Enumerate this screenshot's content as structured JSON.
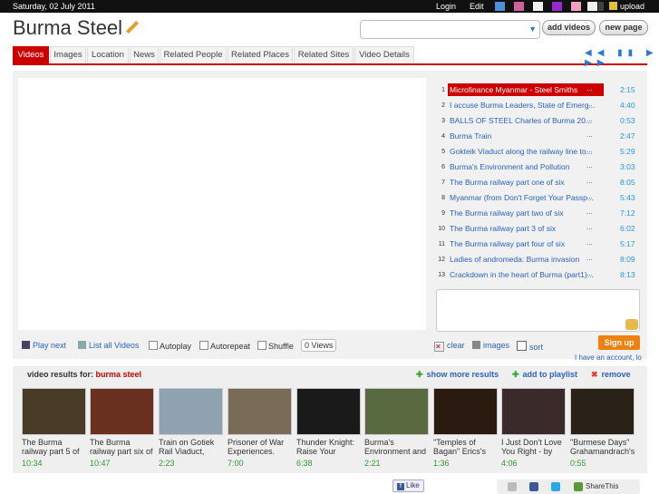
{
  "topbar": {
    "date": "Saturday, 02 July 2011",
    "login": "Login",
    "edit": "Edit",
    "upload": "upload",
    "swatches": [
      "#4a8fd8",
      "#d060a0",
      "#f0f0f0",
      "#9a2ad0",
      "#f0a0c0",
      "#f0f0f0",
      "#404040",
      "#f0f0f0"
    ]
  },
  "brand": {
    "title": "Burma Steel"
  },
  "header": {
    "search_placeholder": "",
    "add_videos": "add videos",
    "new_page": "new page"
  },
  "tabs": [
    "Videos",
    "Images",
    "Location",
    "News",
    "Related People",
    "Related Places",
    "Related Sites",
    "Video Details"
  ],
  "nav": {
    "arrows": "◀◀ ▮▮ ▶ ▶▶"
  },
  "playlist": [
    {
      "n": "1",
      "title": "Microfinance Myanmar - Steel Smiths",
      "dur": "2:15",
      "selected": true
    },
    {
      "n": "2",
      "title": "I accuse Burma Leaders, State of Emerg...",
      "dur": "4:40"
    },
    {
      "n": "3",
      "title": "BALLS OF STEEL Charles of Burma 20...",
      "dur": "0:53"
    },
    {
      "n": "4",
      "title": "Burma Train",
      "dur": "2:47"
    },
    {
      "n": "5",
      "title": "Gokteik Viaduct along the railway line to...",
      "dur": "5:29"
    },
    {
      "n": "6",
      "title": "Burma's Environment and Pollution",
      "dur": "3:03"
    },
    {
      "n": "7",
      "title": "The Burma railway part one of six",
      "dur": "8:05"
    },
    {
      "n": "8",
      "title": "Myanmar (from Don't Forget Your Passp...",
      "dur": "5:43"
    },
    {
      "n": "9",
      "title": "The Burma railway part two of six",
      "dur": "7:12"
    },
    {
      "n": "10",
      "title": "The Burma railway part 3 of six",
      "dur": "6:02"
    },
    {
      "n": "11",
      "title": "The Burma railway part four of six",
      "dur": "5:17"
    },
    {
      "n": "12",
      "title": "Ladies of andromeda: Burma invasion",
      "dur": "8:09"
    },
    {
      "n": "13",
      "title": "Crackdown in the heart of Burma (part1)...",
      "dur": "8:13"
    }
  ],
  "playlist_ellipsis": "...",
  "controls": {
    "play_next": "Play next",
    "list_all": "List all Videos",
    "autoplay": "Autoplay",
    "autorepeat": "Autorepeat",
    "shuffle": "Shuffle",
    "views": "0 Views",
    "clear": "clear",
    "images": "images",
    "sort": "sort",
    "signup": "Sign up",
    "have_account": "I have an account, lo"
  },
  "results": {
    "label": "video results for:",
    "query": "burma steel",
    "show_more": "show more results",
    "add_to_playlist": "add to playlist",
    "remove": "remove"
  },
  "thumbs": [
    {
      "title": "The Burma railway part 5 of",
      "dur": "10:34",
      "color": "#4a3a28"
    },
    {
      "title": "The Burma railway part six of",
      "dur": "10:47",
      "color": "#6a3020"
    },
    {
      "title": "Train on Gotiek Rail Viaduct,",
      "dur": "2:23",
      "color": "#8fa2b0"
    },
    {
      "title": "Prisoner of War Experiences.",
      "dur": "7:00",
      "color": "#7a6a58"
    },
    {
      "title": "Thunder Knight: Raise Your",
      "dur": "6:38",
      "color": "#1a1a1a"
    },
    {
      "title": "Burma's Environment and",
      "dur": "2:21",
      "color": "#5a6a40"
    },
    {
      "title": "\"Temples of Bagan\" Erics's",
      "dur": "1:36",
      "color": "#2a1a10"
    },
    {
      "title": "I Just Don't Love You Right - by",
      "dur": "4:06",
      "color": "#3a2a2a"
    },
    {
      "title": "\"Burmese Days\" Grahamandrach's",
      "dur": "0:55",
      "color": "#2a2218"
    }
  ],
  "footer": {
    "like": "Like",
    "share": "ShareThis"
  }
}
